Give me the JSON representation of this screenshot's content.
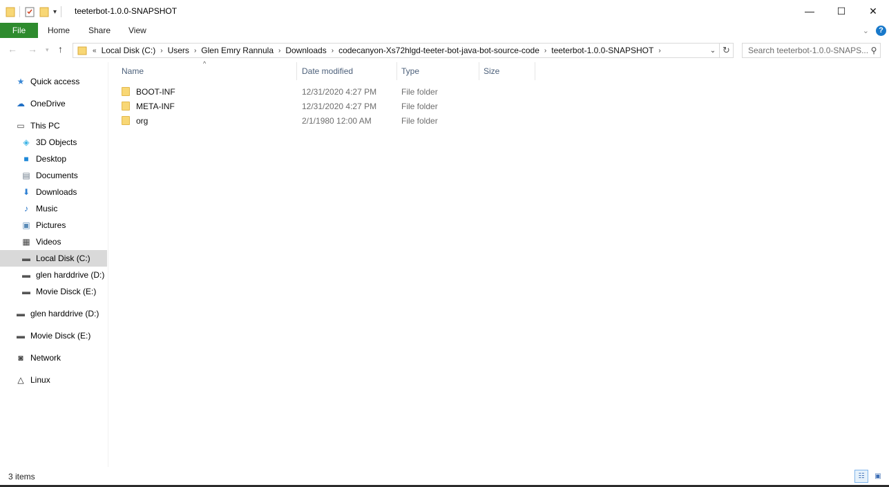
{
  "window": {
    "title": "teeterbot-1.0.0-SNAPSHOT",
    "controls": {
      "minimize": "—",
      "maximize": "☐",
      "close": "✕"
    }
  },
  "ribbon": {
    "tabs": [
      "File",
      "Home",
      "Share",
      "View"
    ],
    "help": "?"
  },
  "address": {
    "overflow": "«",
    "crumbs": [
      "Local Disk (C:)",
      "Users",
      "Glen Emry Rannula",
      "Downloads",
      "codecanyon-Xs72hlgd-teeter-bot-java-bot-source-code",
      "teeterbot-1.0.0-SNAPSHOT"
    ]
  },
  "search": {
    "placeholder": "Search teeterbot-1.0.0-SNAPS..."
  },
  "sidebar": {
    "items": [
      {
        "label": "Quick access",
        "icon": "star-icon",
        "glyph": "★",
        "color": "#3a88d6"
      },
      {
        "label": "OneDrive",
        "icon": "cloud-icon",
        "glyph": "☁",
        "color": "#1f6fc5"
      },
      {
        "label": "This PC",
        "icon": "computer-icon",
        "glyph": "▭",
        "color": "#444444"
      },
      {
        "label": "3D Objects",
        "icon": "cube-icon",
        "glyph": "◈",
        "color": "#3ab3e5"
      },
      {
        "label": "Desktop",
        "icon": "desktop-icon",
        "glyph": "■",
        "color": "#1f88d8"
      },
      {
        "label": "Documents",
        "icon": "document-icon",
        "glyph": "▤",
        "color": "#6d7b8a"
      },
      {
        "label": "Downloads",
        "icon": "download-icon",
        "glyph": "⬇",
        "color": "#2d7fd3"
      },
      {
        "label": "Music",
        "icon": "music-icon",
        "glyph": "♪",
        "color": "#1f6fc5"
      },
      {
        "label": "Pictures",
        "icon": "pictures-icon",
        "glyph": "▣",
        "color": "#5b8cb8"
      },
      {
        "label": "Videos",
        "icon": "video-icon",
        "glyph": "▦",
        "color": "#444444"
      },
      {
        "label": "Local Disk (C:)",
        "icon": "drive-c-icon",
        "glyph": "▬",
        "color": "#555555"
      },
      {
        "label": "glen harddrive (D:)",
        "icon": "drive-d-icon",
        "glyph": "▬",
        "color": "#555555"
      },
      {
        "label": "Movie Disck (E:)",
        "icon": "drive-e-icon",
        "glyph": "▬",
        "color": "#555555"
      },
      {
        "label": "glen harddrive (D:)",
        "icon": "drive-d-icon",
        "glyph": "▬",
        "color": "#555555"
      },
      {
        "label": "Movie Disck (E:)",
        "icon": "drive-e-icon",
        "glyph": "▬",
        "color": "#555555"
      },
      {
        "label": "Network",
        "icon": "network-icon",
        "glyph": "◙",
        "color": "#444444"
      },
      {
        "label": "Linux",
        "icon": "linux-icon",
        "glyph": "△",
        "color": "#222222"
      }
    ],
    "selected_index": 10
  },
  "columns": [
    "Name",
    "Date modified",
    "Type",
    "Size"
  ],
  "files": [
    {
      "name": "BOOT-INF",
      "date": "12/31/2020 4:27 PM",
      "type": "File folder"
    },
    {
      "name": "META-INF",
      "date": "12/31/2020 4:27 PM",
      "type": "File folder"
    },
    {
      "name": "org",
      "date": "2/1/1980 12:00 AM",
      "type": "File folder"
    }
  ],
  "status": {
    "count": "3 items"
  }
}
